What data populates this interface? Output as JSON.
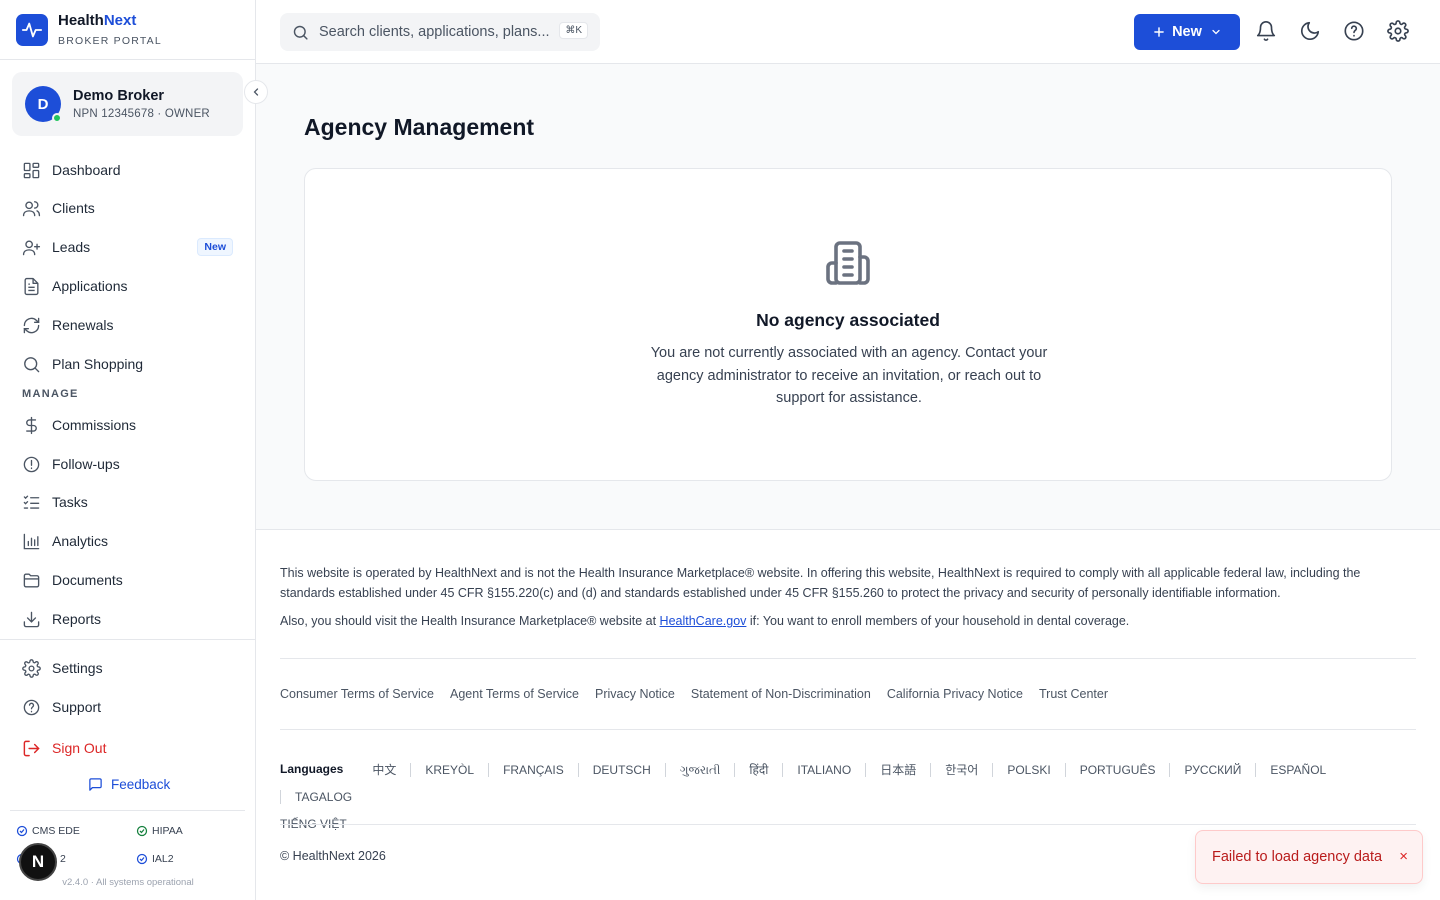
{
  "brand": {
    "name_part1": "Health",
    "name_part2": "Next",
    "subtitle": "BROKER PORTAL"
  },
  "user": {
    "initial": "D",
    "name": "Demo Broker",
    "meta": "NPN 12345678 · OWNER"
  },
  "nav": {
    "primary": [
      {
        "label": "Dashboard",
        "icon": "dashboard-icon"
      },
      {
        "label": "Clients",
        "icon": "users-icon"
      },
      {
        "label": "Leads",
        "icon": "user-plus-icon",
        "badge": "New"
      },
      {
        "label": "Applications",
        "icon": "file-text-icon"
      },
      {
        "label": "Renewals",
        "icon": "refresh-icon"
      },
      {
        "label": "Plan Shopping",
        "icon": "search-icon"
      }
    ],
    "section_label": "MANAGE",
    "manage": [
      {
        "label": "Commissions",
        "icon": "dollar-icon"
      },
      {
        "label": "Follow-ups",
        "icon": "alert-circle-icon"
      },
      {
        "label": "Tasks",
        "icon": "list-checks-icon"
      },
      {
        "label": "Analytics",
        "icon": "bar-chart-icon"
      },
      {
        "label": "Documents",
        "icon": "folder-icon"
      },
      {
        "label": "Reports",
        "icon": "download-icon"
      }
    ],
    "bottom": [
      {
        "label": "Settings",
        "icon": "gear-icon"
      },
      {
        "label": "Support",
        "icon": "help-circle-icon"
      },
      {
        "label": "Sign Out",
        "icon": "logout-icon"
      }
    ],
    "feedback": "Feedback"
  },
  "compliance": [
    "CMS EDE",
    "HIPAA",
    "2",
    "IAL2"
  ],
  "version": "v2.4.0 · All systems operational",
  "dev_badge": "N",
  "topbar": {
    "search_placeholder": "Search clients, applications, plans...",
    "shortcut": "⌘K",
    "new_label": "New"
  },
  "page": {
    "title": "Agency Management",
    "empty_title": "No agency associated",
    "empty_text": "You are not currently associated with an agency. Contact your agency administrator to receive an invitation, or reach out to support for assistance."
  },
  "footer": {
    "disclaimer": "This website is operated by HealthNext and is not the Health Insurance Marketplace® website. In offering this website, HealthNext is required to comply with all applicable federal law, including the standards established under 45 CFR §155.220(c) and (d) and standards established under 45 CFR §155.260 to protect the privacy and security of personally identifiable information.",
    "disclaimer2_pre": "Also, you should visit the Health Insurance Marketplace® website at ",
    "disclaimer2_link": "HealthCare.gov",
    "disclaimer2_post": " if: You want to enroll members of your household in dental coverage.",
    "links": [
      "Consumer Terms of Service",
      "Agent Terms of Service",
      "Privacy Notice",
      "Statement of Non-Discrimination",
      "California Privacy Notice",
      "Trust Center"
    ],
    "languages_label": "Languages",
    "languages": [
      "中文",
      "KREYÒL",
      "FRANÇAIS",
      "DEUTSCH",
      "ગુજરાતી",
      "हिंदी",
      "ITALIANO",
      "日本語",
      "한국어",
      "POLSKI",
      "PORTUGUÊS",
      "РУССКИЙ",
      "ESPAÑOL",
      "TAGALOG",
      "TIẾNG VIỆT"
    ],
    "copyright": "© HealthNext 2026"
  },
  "toast": {
    "message": "Failed to load agency data",
    "close": "×"
  },
  "colors": {
    "accent": "#1d4ed8",
    "danger": "#dc2626",
    "success": "#22c55e"
  }
}
